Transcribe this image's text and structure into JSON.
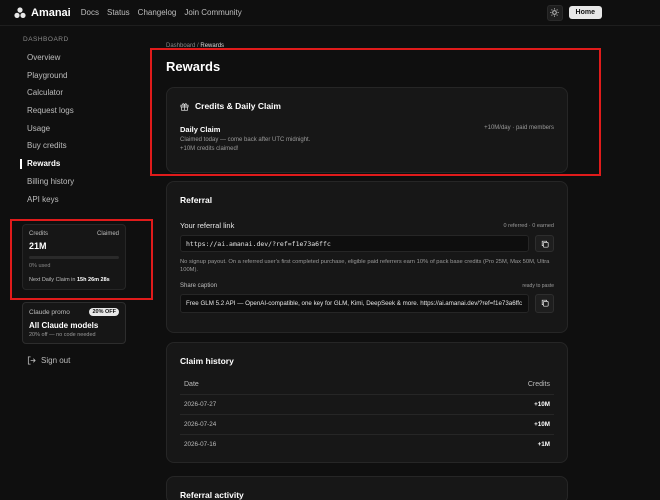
{
  "nav": {
    "brand": "Amanai",
    "links": [
      "Docs",
      "Status",
      "Changelog",
      "Join Community"
    ],
    "home_label": "Home"
  },
  "sidebar": {
    "heading": "DASHBOARD",
    "items": [
      "Overview",
      "Playground",
      "Calculator",
      "Request logs",
      "Usage",
      "Buy credits",
      "Rewards",
      "Billing history",
      "API keys"
    ],
    "active": "Rewards"
  },
  "credits_card": {
    "label": "Credits",
    "status": "Claimed",
    "amount": "21M",
    "used_pct": 0,
    "used_text": "0% used",
    "next_prefix": "Next Daily Claim in",
    "next_time": "15h 26m 28s"
  },
  "promo": {
    "label": "Claude promo",
    "badge": "20% OFF",
    "title": "All Claude models",
    "subtitle": "20% off — no code needed"
  },
  "signout": "Sign out",
  "breadcrumb": {
    "parent": "Dashboard",
    "sep": "/",
    "current": "Rewards"
  },
  "page_title": "Rewards",
  "daily_claim": {
    "title": "Credits & Daily Claim",
    "label": "Daily Claim",
    "rate": "+10M/day · paid members",
    "status": "Claimed today — come back after UTC midnight.",
    "result": "+10M credits claimed!"
  },
  "referral": {
    "title": "Referral",
    "link_label": "Your referral link",
    "stats": "0 referred · 0 earned",
    "link": "https://ai.amanai.dev/?ref=f1e73a6ffc",
    "note": "No signup payout. On a referred user's first completed purchase, eligible paid referrers earn 10% of pack base credits (Pro 25M, Max 50M, Ultra 100M).",
    "caption_label": "Share caption",
    "caption_status": "ready to paste",
    "caption": "Free GLM 5.2 API — OpenAI-compatible, one key for GLM, Kimi, DeepSeek & more. https://ai.amanai.dev/?ref=f1e73a6ffc"
  },
  "claim_history": {
    "title": "Claim history",
    "col_date": "Date",
    "col_credits": "Credits",
    "rows": [
      {
        "date": "2026-07-27",
        "credits": "+10M"
      },
      {
        "date": "2026-07-24",
        "credits": "+10M"
      },
      {
        "date": "2026-07-16",
        "credits": "+1M"
      }
    ]
  },
  "referral_activity": {
    "title": "Referral activity"
  },
  "colors": {
    "highlight": "#e01b1b",
    "background": "#0f0f0f",
    "card": "#171717"
  }
}
